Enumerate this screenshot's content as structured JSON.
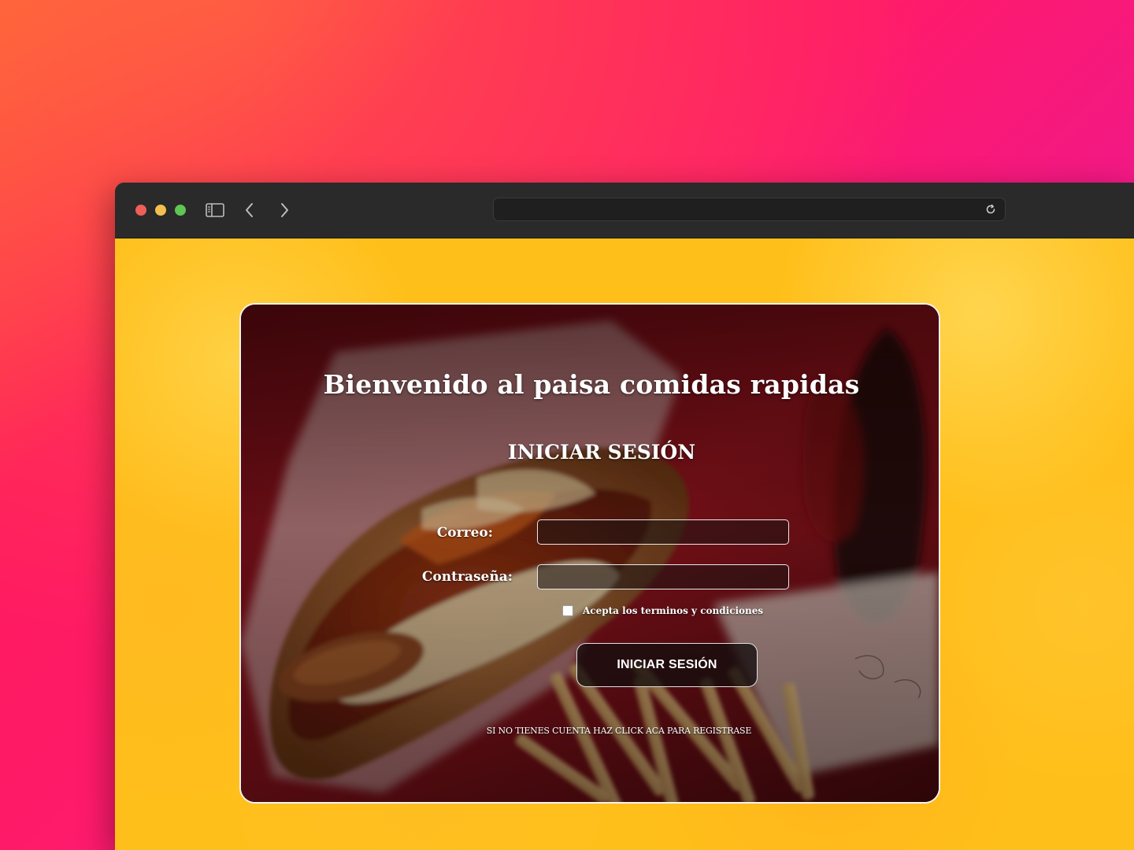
{
  "browser": {
    "url": "",
    "icons": {
      "sidebar": "sidebar-toggle-icon",
      "back": "chevron-left-icon",
      "forward": "chevron-right-icon",
      "reload": "reload-icon"
    }
  },
  "page": {
    "welcome_title": "Bienvenido al paisa comidas rapidas",
    "login_heading": "INICIAR SESIÓN",
    "form": {
      "email_label": "Correo:",
      "email_value": "",
      "password_label": "Contraseña:",
      "password_value": "",
      "terms_label": "Acepta los terminos y condiciones",
      "terms_checked": false,
      "submit_label": "INICIAR SESIÓN"
    },
    "register_link": "SI NO TIENES CUENTA HAZ CLICK ACA PARA REGISTRASE"
  },
  "colors": {
    "page_background": "#ffbf1a",
    "outer_gradient_start": "#ff5a3a",
    "outer_gradient_end": "#c21fb0",
    "card_border": "#f2f2f2",
    "text": "#ffffff"
  }
}
